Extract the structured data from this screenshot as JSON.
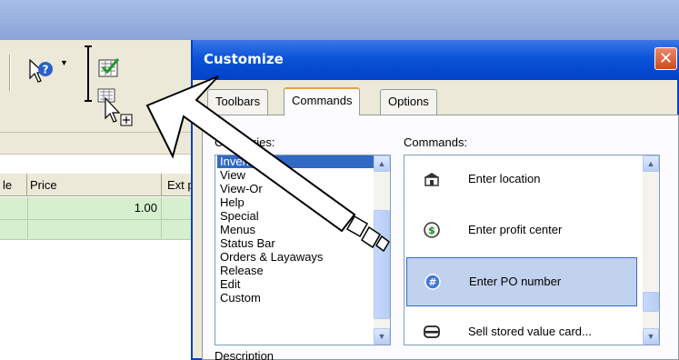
{
  "background_app": {
    "grid_headers": [
      "le",
      "Price",
      "Ext p"
    ],
    "rows": [
      {
        "price": "1.00"
      },
      {
        "price": ""
      }
    ]
  },
  "dialog": {
    "title": "Customize",
    "close_label": "✕",
    "tabs": [
      {
        "label": "Toolbars",
        "selected": false
      },
      {
        "label": "Commands",
        "selected": true
      },
      {
        "label": "Options",
        "selected": false
      }
    ],
    "categories_label": "Categories:",
    "categories": [
      "Invent",
      "View",
      "View-Or",
      "Help",
      "Special",
      "Menus",
      "Status Bar",
      "Orders & Layaways",
      "Release",
      "Edit",
      "Custom"
    ],
    "selected_category": "Invent",
    "commands_label": "Commands:",
    "commands": [
      {
        "label": "Enter location",
        "icon": "location-icon",
        "selected": false
      },
      {
        "label": "Enter profit center",
        "icon": "profit-center-icon",
        "selected": false
      },
      {
        "label": "Enter PO number",
        "icon": "po-number-icon",
        "selected": true
      },
      {
        "label": "Sell stored value card...",
        "icon": "stored-value-card-icon",
        "selected": false
      }
    ],
    "description_label": "Description"
  },
  "colors": {
    "dialog_title": "#0a54d8",
    "selection": "#316ac5",
    "grid_row": "#d6efce"
  }
}
